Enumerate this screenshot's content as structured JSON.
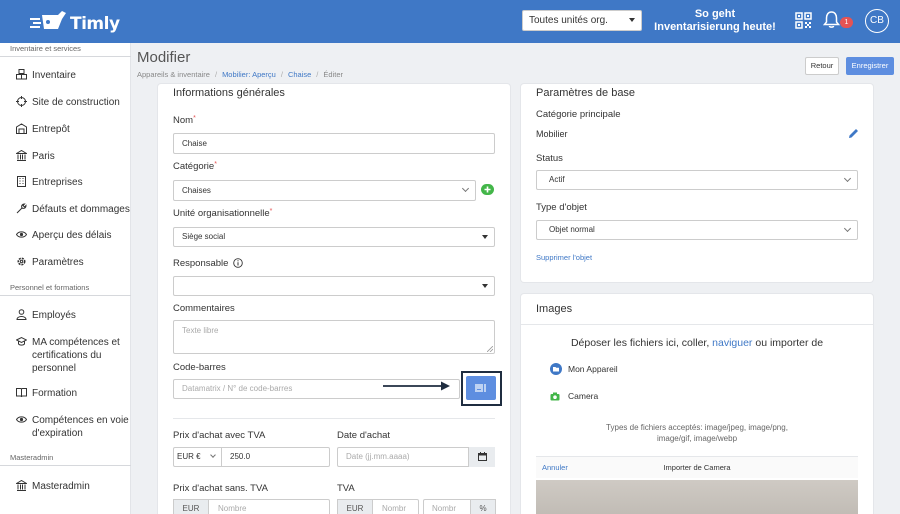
{
  "header": {
    "logo_text": "Timly",
    "org_select": "Toutes unités org.",
    "promo_line1": "So geht",
    "promo_line2": "Inventarisierung heute!",
    "notif_count": "1",
    "avatar_initials": "CB"
  },
  "sidebar": {
    "section1": "Inventaire et services",
    "items1": [
      "Inventaire",
      "Site de construction",
      "Entrepôt",
      "Paris",
      "Entreprises",
      "Défauts et dommages",
      "Aperçu des délais",
      "Paramètres"
    ],
    "section2": "Personnel et formations",
    "items2": [
      "Employés",
      "MA compétences et certifications du personnel",
      "Formation",
      "Compétences en voie d'expiration"
    ],
    "section3": "Masteradmin",
    "items3": [
      "Masteradmin"
    ]
  },
  "page": {
    "title": "Modifier",
    "breadcrumb": [
      "Appareils & inventaire",
      "Mobilier: Aperçu",
      "Chaise",
      "Éditer"
    ],
    "back_label": "Retour",
    "save_label": "Enregistrer"
  },
  "general": {
    "title": "Informations générales",
    "name_label": "Nom",
    "name_value": "Chaise",
    "category_label": "Catégorie",
    "category_value": "Chaises",
    "org_unit_label": "Unité organisationnelle",
    "org_unit_value": "Siège social",
    "responsible_label": "Responsable",
    "comments_label": "Commentaires",
    "comments_placeholder": "Texte libre",
    "barcode_label": "Code-barres",
    "barcode_placeholder": "Datamatrix / N° de code-barres",
    "price_label": "Prix d'achat avec TVA",
    "currency": "EUR €",
    "price_value": "250.0",
    "date_label": "Date d'achat",
    "date_placeholder": "Date (jj.mm.aaaa)",
    "price_net_label": "Prix d'achat sans. TVA",
    "currency2": "EUR",
    "number_placeholder": "Nombre",
    "vat_label": "TVA",
    "currency3": "EUR",
    "number_placeholder2": "Nombr",
    "number_placeholder3": "Nombr",
    "percent": "%"
  },
  "basic": {
    "title": "Paramètres de base",
    "main_category_label": "Catégorie principale",
    "main_category_value": "Mobilier",
    "status_label": "Status",
    "status_value": "Actif",
    "object_type_label": "Type d'objet",
    "object_type_value": "Objet normal",
    "delete_link": "Supprimer l'objet"
  },
  "images": {
    "title": "Images",
    "drop_text_before": "Déposer les fichiers ici, coller, ",
    "drop_link": "naviguer",
    "drop_text_after": " ou importer de",
    "source1": "Mon Appareil",
    "source2": "Camera",
    "accepted1": "Types de fichiers acceptés: image/jpeg, image/png,",
    "accepted2": "image/gif, image/webp",
    "cancel": "Annuler",
    "camera_title": "Importer de Camera"
  },
  "colors": {
    "brand": "#3f78c6",
    "primary_button": "#5e8ee0",
    "success": "#43b649",
    "danger": "#e55353",
    "highlight_box": "#1f2d40"
  }
}
